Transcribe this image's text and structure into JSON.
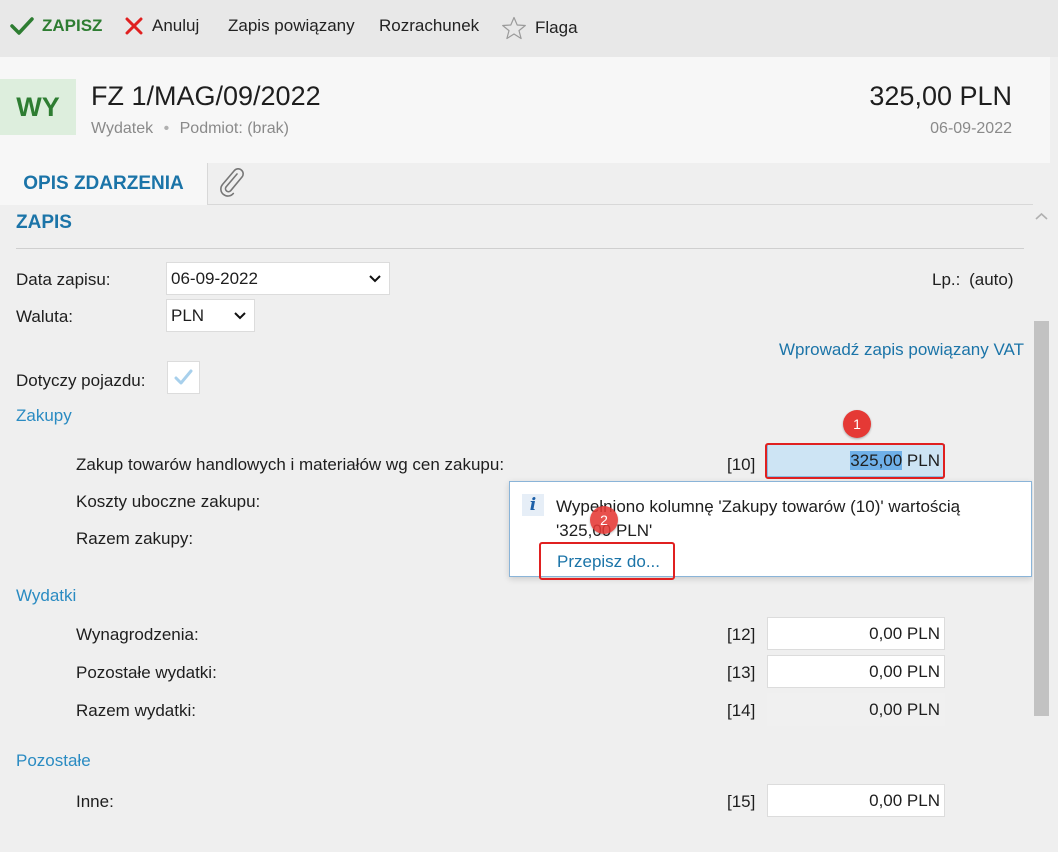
{
  "toolbar": {
    "save_label": "ZAPISZ",
    "cancel_label": "Anuluj",
    "linked_entry_label": "Zapis powiązany",
    "settlement_label": "Rozrachunek",
    "flag_label": "Flaga"
  },
  "header": {
    "badge": "WY",
    "title": "FZ 1/MAG/09/2022",
    "type": "Wydatek",
    "subject": "Podmiot: (brak)",
    "amount": "325,00 PLN",
    "date": "06-09-2022"
  },
  "tabs": {
    "description_label": "OPIS ZDARZENIA"
  },
  "section": {
    "title": "ZAPIS"
  },
  "form": {
    "date_label": "Data zapisu:",
    "date_value": "06-09-2022",
    "currency_label": "Waluta:",
    "currency_value": "PLN",
    "lp_label": "Lp.:",
    "lp_value": "(auto)",
    "vat_link": "Wprowadź zapis powiązany VAT",
    "vehicle_label": "Dotyczy pojazdu:"
  },
  "purchases": {
    "group": "Zakupy",
    "rows": [
      {
        "label": "Zakup towarów handlowych i materiałów wg cen zakupu:",
        "code": "[10]",
        "value_num": "325,00",
        "value_cur": " PLN"
      },
      {
        "label": "Koszty uboczne zakupu:"
      },
      {
        "label": "Razem zakupy:"
      }
    ]
  },
  "popup": {
    "message": "Wypełniono kolumnę 'Zakupy towarów (10)' wartością '325,00 PLN'",
    "link": "Przepisz do..."
  },
  "markers": [
    "1",
    "2"
  ],
  "expenses": {
    "group": "Wydatki",
    "rows": [
      {
        "label": "Wynagrodzenia:",
        "code": "[12]",
        "value": "0,00 PLN"
      },
      {
        "label": "Pozostałe wydatki:",
        "code": "[13]",
        "value": "0,00 PLN"
      },
      {
        "label": "Razem wydatki:",
        "code": "[14]",
        "value": "0,00 PLN"
      }
    ]
  },
  "other": {
    "group": "Pozostałe",
    "rows": [
      {
        "label": "Inne:",
        "code": "[15]",
        "value": "0,00 PLN"
      }
    ]
  },
  "colors": {
    "accent": "#1b74a8",
    "save_green": "#2e7d32",
    "cancel_red": "#e02020",
    "marker_red": "#e53935"
  }
}
